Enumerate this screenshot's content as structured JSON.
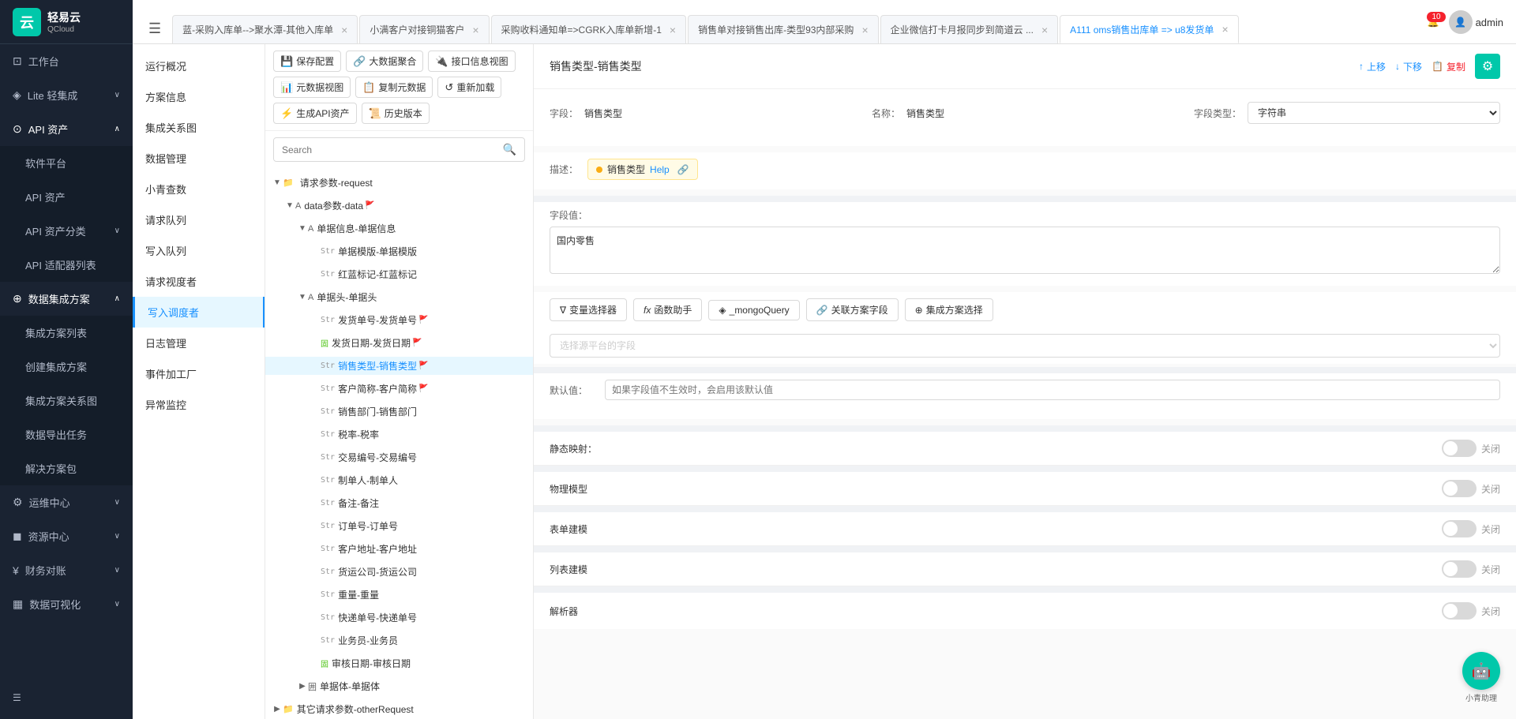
{
  "app": {
    "logo_text": "轻易云",
    "logo_sub": "QCloud",
    "notification_count": "10",
    "username": "admin"
  },
  "sidebar": {
    "items": [
      {
        "id": "workbench",
        "label": "工作台",
        "icon": "⊡",
        "has_arrow": false
      },
      {
        "id": "lite",
        "label": "Lite 轻集成",
        "icon": "◈",
        "has_arrow": true
      },
      {
        "id": "api",
        "label": "API 资产",
        "icon": "⊙",
        "has_arrow": true,
        "expanded": true
      },
      {
        "id": "software",
        "label": "软件平台",
        "icon": "",
        "is_sub": true
      },
      {
        "id": "api-asset",
        "label": "API 资产",
        "icon": "",
        "is_sub": true
      },
      {
        "id": "api-category",
        "label": "API 资产分类",
        "icon": "",
        "is_sub": true,
        "has_arrow": true
      },
      {
        "id": "api-adapter",
        "label": "API 适配器列表",
        "icon": "",
        "is_sub": true
      },
      {
        "id": "data-integration",
        "label": "数据集成方案",
        "icon": "⊕",
        "has_arrow": true,
        "expanded": true
      },
      {
        "id": "integration-list",
        "label": "集成方案列表",
        "icon": "",
        "is_sub": true
      },
      {
        "id": "create-integration",
        "label": "创建集成方案",
        "icon": "",
        "is_sub": true
      },
      {
        "id": "integration-relation",
        "label": "集成方案关系图",
        "icon": "",
        "is_sub": true
      },
      {
        "id": "data-export",
        "label": "数据导出任务",
        "icon": "",
        "is_sub": true
      },
      {
        "id": "solution-package",
        "label": "解决方案包",
        "icon": "",
        "is_sub": true
      },
      {
        "id": "ops",
        "label": "运维中心",
        "icon": "⚙",
        "has_arrow": true
      },
      {
        "id": "resources",
        "label": "资源中心",
        "icon": "◼",
        "has_arrow": true
      },
      {
        "id": "finance",
        "label": "财务对账",
        "icon": "¥",
        "has_arrow": true
      },
      {
        "id": "data-vis",
        "label": "数据可视化",
        "icon": "▦",
        "has_arrow": true
      }
    ]
  },
  "tabs": [
    {
      "id": "tab1",
      "label": "蓝-采购入库单-->聚水潭-其他入库单",
      "active": false,
      "closable": true
    },
    {
      "id": "tab2",
      "label": "小满客户对接铜猫客户",
      "active": false,
      "closable": true
    },
    {
      "id": "tab3",
      "label": "采购收料通知单=>CGRK入库单新增-1",
      "active": false,
      "closable": true
    },
    {
      "id": "tab4",
      "label": "销售单对接销售出库-类型93内部采购",
      "active": false,
      "closable": true
    },
    {
      "id": "tab5",
      "label": "企业微信打卡月报同步到简道云 ...",
      "active": false,
      "closable": true
    },
    {
      "id": "tab6",
      "label": "A111 oms销售出库单 => u8发货单",
      "active": true,
      "closable": true
    }
  ],
  "left_nav": {
    "items": [
      {
        "id": "overview",
        "label": "运行概况"
      },
      {
        "id": "solution-info",
        "label": "方案信息"
      },
      {
        "id": "integration-graph",
        "label": "集成关系图"
      },
      {
        "id": "data-mgmt",
        "label": "数据管理"
      },
      {
        "id": "xq",
        "label": "小青查数"
      },
      {
        "id": "request-queue",
        "label": "请求队列"
      },
      {
        "id": "write-queue",
        "label": "写入队列"
      },
      {
        "id": "request-degree",
        "label": "请求视度者"
      },
      {
        "id": "write-degree",
        "label": "写入调度者",
        "active": true
      },
      {
        "id": "log-mgmt",
        "label": "日志管理"
      },
      {
        "id": "event-factory",
        "label": "事件加工厂"
      },
      {
        "id": "error-monitor",
        "label": "异常监控"
      }
    ]
  },
  "toolbar": {
    "buttons": [
      {
        "id": "save-config",
        "icon": "💾",
        "label": "保存配置"
      },
      {
        "id": "big-data-merge",
        "icon": "🔗",
        "label": "大数据聚合"
      },
      {
        "id": "interface-view",
        "icon": "🔌",
        "label": "接口信息视图"
      },
      {
        "id": "meta-view",
        "icon": "📊",
        "label": "元数据视图"
      },
      {
        "id": "copy-meta",
        "icon": "📋",
        "label": "复制元数据"
      },
      {
        "id": "reload",
        "icon": "↺",
        "label": "重新加载"
      },
      {
        "id": "gen-api",
        "icon": "⚡",
        "label": "生成API资产"
      },
      {
        "id": "history",
        "icon": "📜",
        "label": "历史版本"
      }
    ]
  },
  "search": {
    "placeholder": "Search"
  },
  "tree": {
    "nodes": [
      {
        "id": "n1",
        "level": 0,
        "type": "folder",
        "label": "请求参数-request",
        "expanded": true,
        "toggle": "▼"
      },
      {
        "id": "n2",
        "level": 1,
        "type": "A",
        "label": "data参数-data",
        "expanded": true,
        "toggle": "▼",
        "flag": true
      },
      {
        "id": "n3",
        "level": 2,
        "type": "A",
        "label": "单据信息-单据信息",
        "expanded": true,
        "toggle": "▼"
      },
      {
        "id": "n4",
        "level": 3,
        "type": "Str",
        "label": "单据模版-单据模版",
        "toggle": ""
      },
      {
        "id": "n5",
        "level": 3,
        "type": "Str",
        "label": "红蓝标记-红蓝标记",
        "toggle": ""
      },
      {
        "id": "n6",
        "level": 2,
        "type": "A",
        "label": "单据头-单据头",
        "expanded": true,
        "toggle": "▼"
      },
      {
        "id": "n7",
        "level": 3,
        "type": "Str",
        "label": "发货单号-发货单号",
        "toggle": "",
        "flag": true
      },
      {
        "id": "n8",
        "level": 3,
        "type": "固",
        "label": "发货日期-发货日期",
        "toggle": "",
        "flag": true
      },
      {
        "id": "n9",
        "level": 3,
        "type": "Str",
        "label": "销售类型-销售类型",
        "toggle": "",
        "flag": true,
        "selected": true
      },
      {
        "id": "n10",
        "level": 3,
        "type": "Str",
        "label": "客户简称-客户简称",
        "toggle": "",
        "flag": true
      },
      {
        "id": "n11",
        "level": 3,
        "type": "Str",
        "label": "销售部门-销售部门",
        "toggle": ""
      },
      {
        "id": "n12",
        "level": 3,
        "type": "Str",
        "label": "税率-税率",
        "toggle": ""
      },
      {
        "id": "n13",
        "level": 3,
        "type": "Str",
        "label": "交易编号-交易编号",
        "toggle": ""
      },
      {
        "id": "n14",
        "level": 3,
        "type": "Str",
        "label": "制单人-制单人",
        "toggle": ""
      },
      {
        "id": "n15",
        "level": 3,
        "type": "Str",
        "label": "备注-备注",
        "toggle": ""
      },
      {
        "id": "n16",
        "level": 3,
        "type": "Str",
        "label": "订单号-订单号",
        "toggle": ""
      },
      {
        "id": "n17",
        "level": 3,
        "type": "Str",
        "label": "客户地址-客户地址",
        "toggle": ""
      },
      {
        "id": "n18",
        "level": 3,
        "type": "Str",
        "label": "货运公司-货运公司",
        "toggle": ""
      },
      {
        "id": "n19",
        "level": 3,
        "type": "Str",
        "label": "重量-重量",
        "toggle": ""
      },
      {
        "id": "n20",
        "level": 3,
        "type": "Str",
        "label": "快递单号-快递单号",
        "toggle": ""
      },
      {
        "id": "n21",
        "level": 3,
        "type": "Str",
        "label": "业务员-业务员",
        "toggle": ""
      },
      {
        "id": "n22",
        "level": 3,
        "type": "固",
        "label": "审核日期-审核日期",
        "toggle": ""
      },
      {
        "id": "n23",
        "level": 2,
        "type": "囲",
        "label": "单据体-单据体",
        "toggle": "▶",
        "expanded": false
      },
      {
        "id": "n24",
        "level": 0,
        "type": "folder",
        "label": "其它请求参数-otherRequest",
        "expanded": false,
        "toggle": "▶"
      }
    ]
  },
  "detail": {
    "title": "销售类型-销售类型",
    "actions": {
      "up": "上移",
      "down": "下移",
      "copy": "复制"
    },
    "field_row": {
      "field_label": "字段：",
      "field_value": "销售类型",
      "name_label": "名称：",
      "name_value": "销售类型",
      "type_label": "字段类型：",
      "type_value": "字符串"
    },
    "desc_label": "描述：",
    "desc_text": "销售类型",
    "desc_help": "Help",
    "field_value_label": "字段值：",
    "field_value_text": "国内零售",
    "tools": [
      {
        "id": "var-selector",
        "icon": "∇",
        "label": "变量选择器"
      },
      {
        "id": "func-helper",
        "icon": "fx",
        "label": "函数助手"
      },
      {
        "id": "mongo-query",
        "icon": "◈",
        "label": "_mongoQuery"
      },
      {
        "id": "related-field",
        "icon": "🔗",
        "label": "关联方案字段"
      },
      {
        "id": "integration-select",
        "icon": "⊕",
        "label": "集成方案选择"
      }
    ],
    "source_placeholder": "选择源平台的字段",
    "default_label": "默认值：",
    "default_placeholder": "如果字段值不生效时，会启用该默认值",
    "static_map_label": "静态映射：",
    "static_map_value": "关闭",
    "physical_model_label": "物理模型",
    "physical_model_value": "关闭",
    "table_build_label": "表单建模",
    "table_build_value": "关闭",
    "list_build_label": "列表建模",
    "list_build_value": "关闭",
    "parser_label": "解析器",
    "assistant_label": "小青助理"
  }
}
